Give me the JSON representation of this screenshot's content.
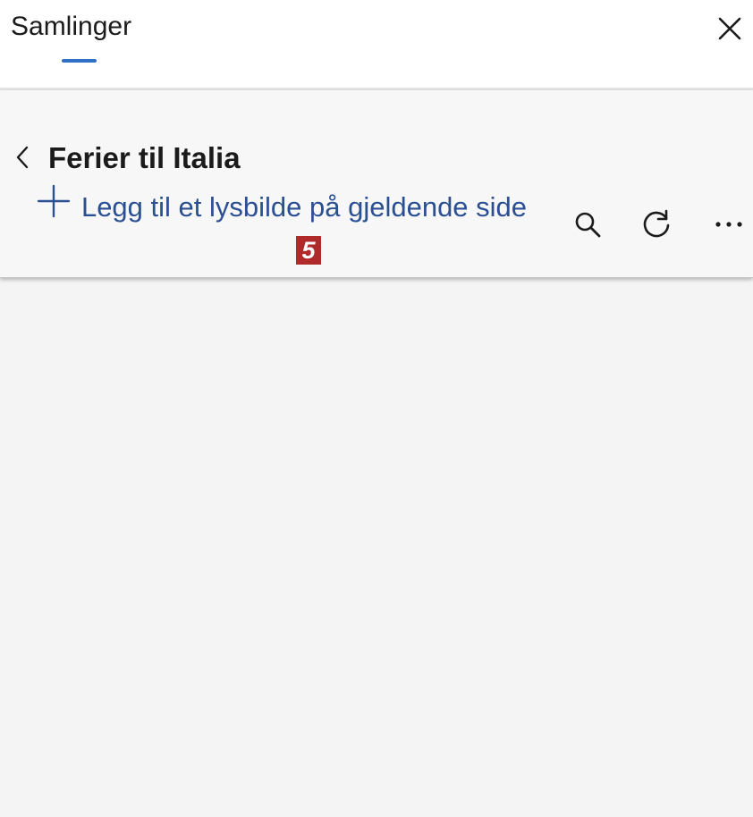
{
  "header": {
    "title": "Samlinger",
    "accent_color": "#2f6fc6",
    "close_icon": "close-icon"
  },
  "collection": {
    "back_icon": "chevron-left-icon",
    "title": "Ferier til Italia",
    "add_slide_label": "Legg til et lysbilde på gjeldende side",
    "add_icon": "plus-icon",
    "link_color": "#2b4f93",
    "badge": "5",
    "badge_color": "#b02a2a",
    "toolbar_icons": [
      "search-icon",
      "refresh-icon",
      "more-icon"
    ]
  }
}
